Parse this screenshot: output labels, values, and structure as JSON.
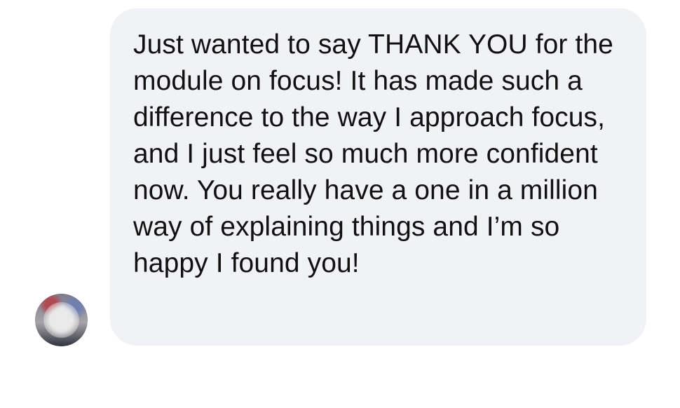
{
  "message": {
    "text": "Just wanted to say THANK YOU for the module on focus! It has made such a difference to the way I approach focus, and I just feel so much more confident now. You really have a one in a million way of explaining things and I’m so happy I found you!"
  },
  "colors": {
    "page_background": "#ffffff",
    "bubble_background": "#f1f2f5",
    "text": "#111111"
  }
}
